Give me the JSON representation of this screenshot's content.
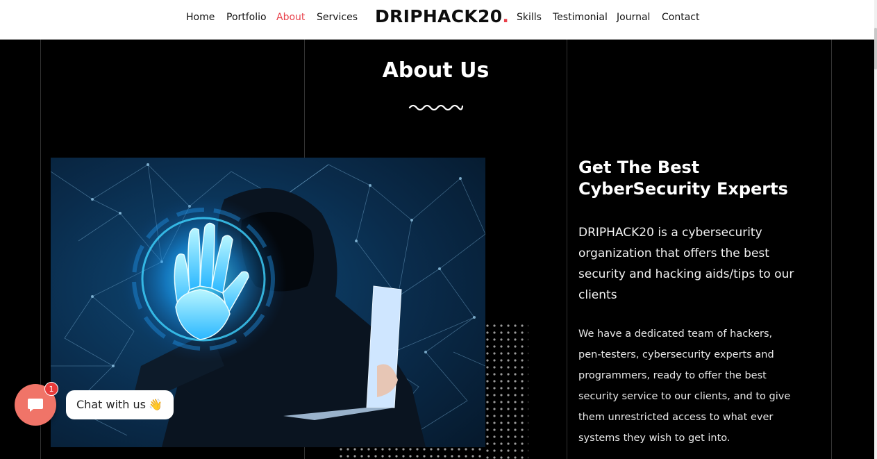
{
  "nav": {
    "left": [
      "Home",
      "Portfolio",
      "About",
      "Services"
    ],
    "right": [
      "Skills",
      "Testimonial",
      "Journal",
      "Contact"
    ],
    "active": "About"
  },
  "logo": {
    "text": "DRIPHACK20",
    "dot": "."
  },
  "section": {
    "title": "About Us"
  },
  "aside": {
    "heading": "Get The Best CyberSecurity Experts",
    "para1": "DRIPHACK20 is a cybersecurity organization that offers the best security and hacking aids/tips to our clients",
    "para2": "We have a dedicated team of hackers, pen-testers, cybersecurity experts and programmers, ready to offer the best security service to our clients, and to give them unrestricted access to what ever systems they wish to get into."
  },
  "chat": {
    "label": "Chat with us",
    "badge": "1",
    "wave": "👋"
  },
  "colors": {
    "accent": "#e8404a",
    "chat_button": "#f07468",
    "background": "#000000"
  },
  "icons": {
    "chat": "chat-bubble-icon",
    "wave": "waving-hand-icon"
  }
}
